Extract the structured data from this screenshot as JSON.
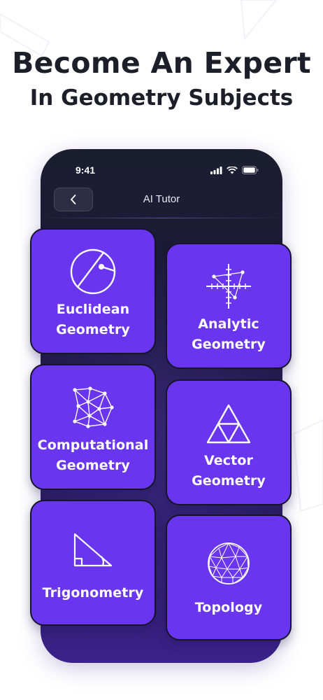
{
  "headline": {
    "line1": "Become An Expert",
    "line2": "In Geometry Subjects"
  },
  "phone": {
    "status_time": "9:41",
    "title": "AI Tutor"
  },
  "subjects": [
    {
      "label": "Euclidean\nGeometry",
      "icon": "circle-chord-icon"
    },
    {
      "label": "Analytic\nGeometry",
      "icon": "coordinate-plane-icon"
    },
    {
      "label": "Computational\nGeometry",
      "icon": "mesh-network-icon"
    },
    {
      "label": "Vector\nGeometry",
      "icon": "triangle-subdivided-icon"
    },
    {
      "label": "Trigonometry",
      "icon": "right-triangle-icon"
    },
    {
      "label": "Topology",
      "icon": "wireframe-sphere-icon"
    }
  ],
  "colors": {
    "card": "#6a35ef",
    "headline": "#1c1f2a",
    "phone_bg": "#1e1a3e"
  }
}
